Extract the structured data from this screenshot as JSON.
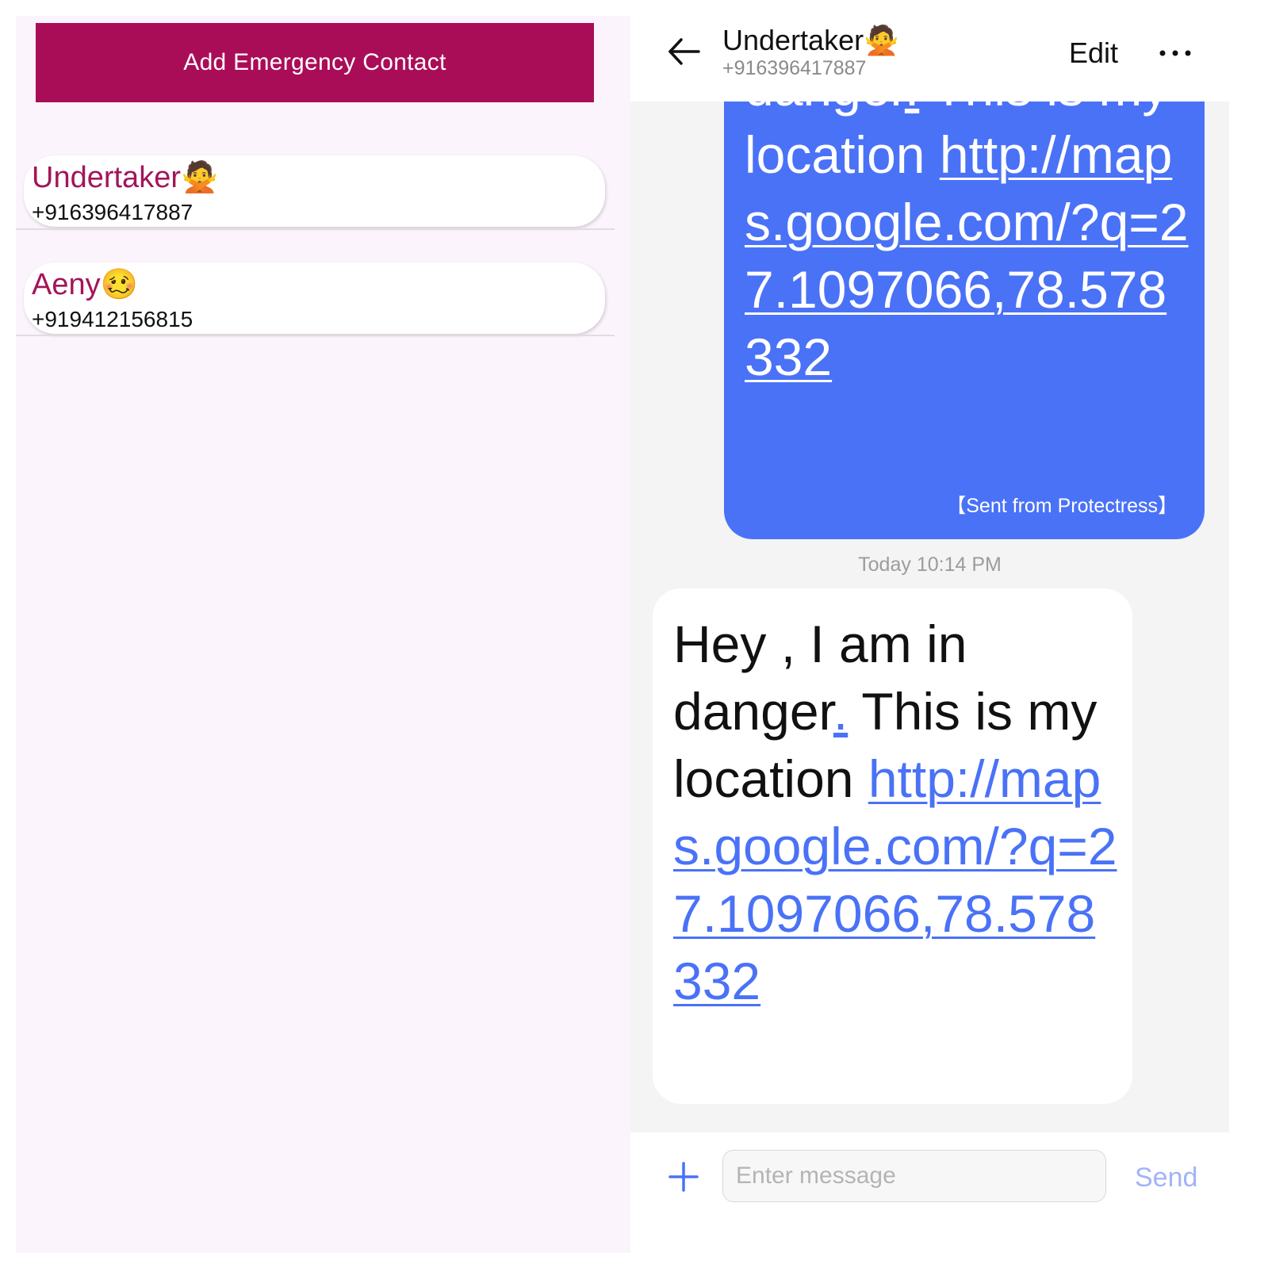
{
  "contacts_app": {
    "add_button_label": "Add Emergency Contact",
    "contacts": [
      {
        "name": "Undertaker🙅",
        "phone": "+916396417887"
      },
      {
        "name": "Aeny🥴",
        "phone": "+919412156815"
      }
    ],
    "colors": {
      "accent": "#aa0d58",
      "name_text": "#a3155a",
      "background": "#fcf4fc"
    }
  },
  "messages_app": {
    "header": {
      "contact_name": "Undertaker🙅",
      "contact_phone": "+916396417887",
      "edit_label": "Edit",
      "back_icon": "arrow-left-icon",
      "more_icon": "more-horizontal-icon"
    },
    "sent_message": {
      "text_before": "danger",
      "text_dot": ".",
      "text_after": " This is my location ",
      "link": "http://maps.google.com/?q=27.1097066,78.578332",
      "footer": "【Sent from Protectress】"
    },
    "timestamp": "Today 10:14 PM",
    "received_message": {
      "text_prefix": "Hey , I am in danger",
      "text_dot": ".",
      "text_after": " This is my location ",
      "link": "http://maps.google.com/?q=27.1097066,78.578332"
    },
    "input": {
      "placeholder": "Enter message",
      "value": "",
      "send_label": "Send",
      "plus_icon": "plus-icon"
    },
    "colors": {
      "sent_bubble": "#4a72f7",
      "link": "#4a72f7",
      "chat_background": "#f4f4f4",
      "send_disabled": "#9fb4f8"
    }
  }
}
